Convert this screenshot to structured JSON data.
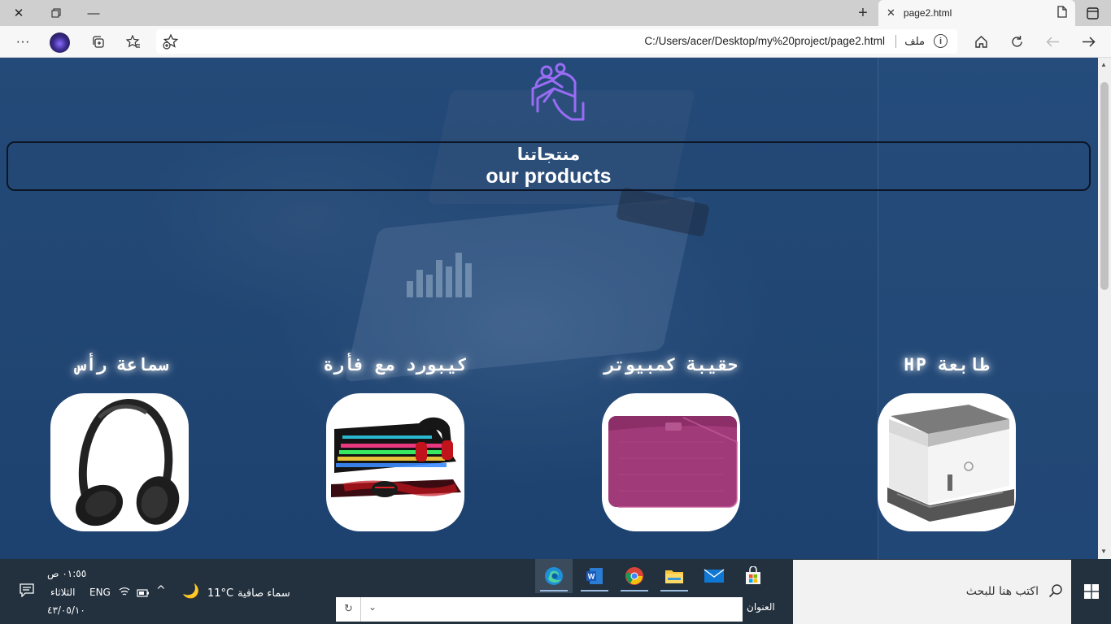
{
  "browser": {
    "tab_title": "page2.html",
    "address_url": "C:/Users/acer/Desktop/my%20project/page2.html",
    "address_scheme_label": "ملف",
    "icons": [
      "close-icon",
      "restore-icon",
      "minimize-icon",
      "new-tab-icon",
      "page-icon",
      "tab-actions-icon",
      "more-icon",
      "collections-icon",
      "favorites-icon",
      "add-favorite-icon",
      "info-icon",
      "home-icon",
      "refresh-icon",
      "back-icon",
      "forward-icon"
    ]
  },
  "page": {
    "heading_ar": "منتجاتنا",
    "heading_en": "our products",
    "products": [
      {
        "title": "سماعة رأس",
        "image": "headphones"
      },
      {
        "title": "كيبورد مع فأرة",
        "image": "keyboard-mouse-set"
      },
      {
        "title": "حقيبة كمبيوتر",
        "image": "laptop-sleeve"
      },
      {
        "title": "طابعة HP",
        "image": "printer"
      }
    ]
  },
  "taskbar": {
    "search_placeholder": "اكتب هنا للبحث",
    "address_label": "العنوان",
    "weather": "سماء صافية",
    "temperature": "11°C",
    "language": "ENG",
    "time": "٠١:٥٥ ص",
    "day": "الثلاثاء",
    "date": "٤٣/٠٥/١٠",
    "apps": [
      "edge",
      "word",
      "chrome",
      "file-explorer",
      "mail",
      "store"
    ]
  },
  "colors": {
    "page_bg": "#264a74",
    "tab_bar": "#cfcfcf",
    "taskbar": "#23313f",
    "logo_purple": "#8a5cf0"
  }
}
